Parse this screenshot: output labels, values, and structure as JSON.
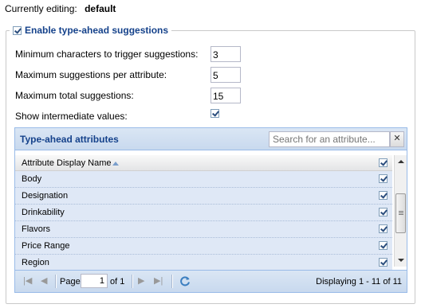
{
  "header": {
    "label": "Currently editing:",
    "value": "default"
  },
  "fieldset": {
    "legend": "Enable type-ahead suggestions",
    "enabled": true
  },
  "form": {
    "min_chars": {
      "label": "Minimum characters to trigger suggestions:",
      "value": "3"
    },
    "max_per_attr": {
      "label": "Maximum suggestions per attribute:",
      "value": "5"
    },
    "max_total": {
      "label": "Maximum total suggestions:",
      "value": "15"
    },
    "show_intermediate": {
      "label": "Show intermediate values:",
      "checked": true
    }
  },
  "grid": {
    "title": "Type-ahead attributes",
    "search_placeholder": "Search for an attribute...",
    "clear_label": "✕",
    "column_header": "Attribute Display Name",
    "rows": [
      {
        "label": "Body",
        "checked": true
      },
      {
        "label": "Designation",
        "checked": true
      },
      {
        "label": "Drinkability",
        "checked": true
      },
      {
        "label": "Flavors",
        "checked": true
      },
      {
        "label": "Price Range",
        "checked": true
      },
      {
        "label": "Region",
        "checked": true
      }
    ]
  },
  "pager": {
    "page_label": "Page",
    "page_value": "1",
    "of_label": "of 1",
    "displaying": "Displaying 1 - 11 of 11"
  }
}
